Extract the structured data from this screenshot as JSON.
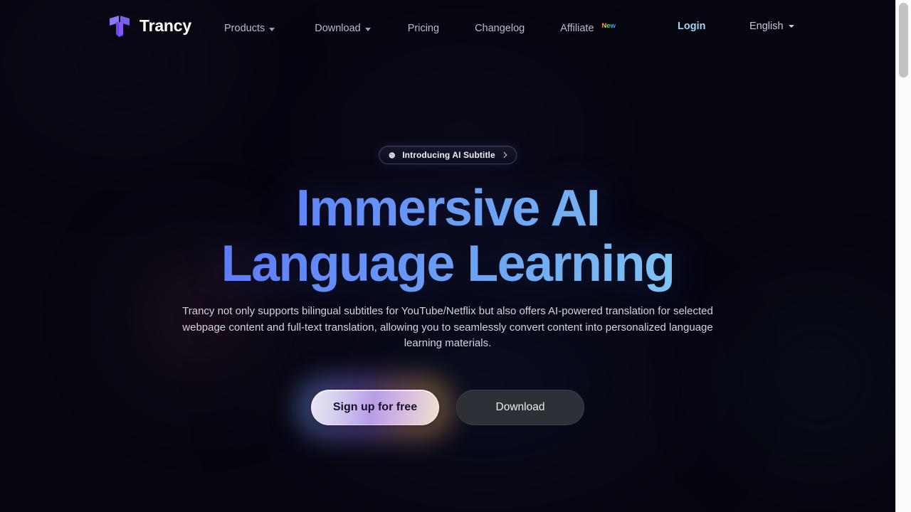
{
  "brand": {
    "name": "Trancy",
    "logo_icon": "trancy-t-logo",
    "logo_color": "#7b5cf0"
  },
  "header": {
    "nav_items": [
      {
        "label": "Products",
        "has_dropdown": true,
        "badge": ""
      },
      {
        "label": "Download",
        "has_dropdown": true,
        "badge": ""
      },
      {
        "label": "Pricing",
        "has_dropdown": false,
        "badge": ""
      },
      {
        "label": "Changelog",
        "has_dropdown": false,
        "badge": ""
      },
      {
        "label": "Affiliate",
        "has_dropdown": false,
        "badge": "New"
      }
    ],
    "login_label": "Login",
    "login_color": "#9fd8f5",
    "language_label": "English",
    "dropdown_icon": "chevron-down-icon",
    "caret_icon": "caret-down-icon"
  },
  "hero": {
    "badge": {
      "icon": "sparkle-icon",
      "text": "Introducing AI Subtitle",
      "chevron": "chevron-right-icon"
    },
    "headline_line1": "Immersive AI",
    "headline_line2": "Language Learning",
    "headline_gradient_from": "#4060f5",
    "headline_gradient_to": "#9adcf7",
    "subtitle": "Trancy not only supports bilingual subtitles for YouTube/Netflix but also offers AI-powered translation for selected webpage content and full-text translation, allowing you to seamlessly convert content into personalized language learning materials.",
    "primary_cta": "Sign up for free",
    "secondary_cta": "Download"
  },
  "theme": {
    "background": "#060610",
    "text_primary": "#ffffff",
    "text_muted": "#b8bcc8",
    "accent_purple": "#7b5cf0",
    "accent_cyan": "#9fd8f5"
  },
  "scrollbar": {
    "name": "page-scrollbar",
    "thumb_position": "top"
  }
}
